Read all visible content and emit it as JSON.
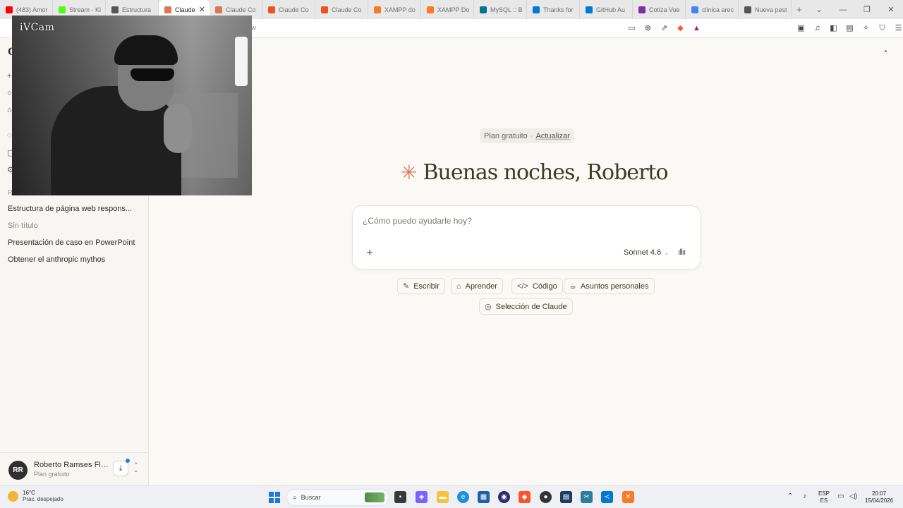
{
  "browser": {
    "tabs": [
      {
        "label": "(483) Amor",
        "color": "#ff0000"
      },
      {
        "label": "Stream - Ki",
        "color": "#53fc18"
      },
      {
        "label": "Estructura",
        "color": "#555555"
      },
      {
        "label": "Claude",
        "color": "#d97757",
        "active": true
      },
      {
        "label": "Claude Co",
        "color": "#d97757"
      },
      {
        "label": "Claude Co",
        "color": "#f25022"
      },
      {
        "label": "Claude Co",
        "color": "#f25022"
      },
      {
        "label": "XAMPP do",
        "color": "#fb7a24"
      },
      {
        "label": "XAMPP Do",
        "color": "#fb7a24"
      },
      {
        "label": "MySQL :: B",
        "color": "#00758f"
      },
      {
        "label": "Thanks for",
        "color": "#0078d4"
      },
      {
        "label": "GitHub Au",
        "color": "#0078d4"
      },
      {
        "label": "Cotiza Vue",
        "color": "#7b2fa0"
      },
      {
        "label": "clinica arec",
        "color": "#4285f4"
      },
      {
        "label": "Nueva pest",
        "color": "#555555"
      }
    ],
    "close_glyph": "✕",
    "new_tab_glyph": "+",
    "url_tail": "w"
  },
  "webcam": {
    "label": "iVCam"
  },
  "sidebar": {
    "brand_letter": "C",
    "recents_label": "R",
    "recents": [
      {
        "label": "Estructura de página web respons...",
        "muted": false
      },
      {
        "label": "Sin título",
        "muted": true
      },
      {
        "label": "Presentación de caso en PowerPoint",
        "muted": false
      },
      {
        "label": "Obtener el anthropic mythos",
        "muted": false
      }
    ],
    "user": {
      "initials": "RR",
      "name": "Roberto Ramses Flo...",
      "plan": "Plan gratuito"
    }
  },
  "main": {
    "plan_label": "Plan gratuito",
    "plan_sep": "·",
    "upgrade_label": "Actualizar",
    "greeting": "Buenas noches, Roberto",
    "composer": {
      "placeholder": "¿Cómo puedo ayudarle hoy?",
      "model": "Sonnet 4.6"
    },
    "chips": [
      {
        "label": "Escribir",
        "icon": "pencil-icon"
      },
      {
        "label": "Aprender",
        "icon": "graduation-cap-icon"
      },
      {
        "label": "Código",
        "icon": "code-icon"
      },
      {
        "label": "Asuntos personales",
        "icon": "coffee-icon"
      },
      {
        "label": "Selección de Claude",
        "icon": "lightbulb-icon"
      }
    ],
    "accent_color": "#d97757"
  },
  "taskbar": {
    "weather_temp": "16°C",
    "weather_desc": "Prac. despejado",
    "search_label": "Buscar",
    "lang_top": "ESP",
    "lang_bottom": "ES",
    "time": "20:07",
    "date": "15/04/2026"
  }
}
